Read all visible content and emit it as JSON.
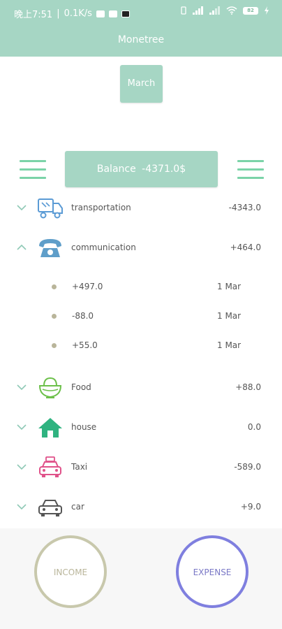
{
  "status_bar": {
    "time": "晚上7:51",
    "speed": "0.1K/s",
    "battery": "82"
  },
  "app": {
    "title": "Monetree"
  },
  "month_button": "March",
  "balance": {
    "label": "Balance",
    "value": "-4371.0$"
  },
  "categories": [
    {
      "label": "transportation",
      "amount": "-4343.0",
      "icon": "truck-icon",
      "expanded": false
    },
    {
      "label": "communication",
      "amount": "+464.0",
      "icon": "telephone-icon",
      "expanded": true,
      "entries": [
        {
          "amount": "+497.0",
          "date": "1 Mar"
        },
        {
          "amount": "-88.0",
          "date": "1 Mar"
        },
        {
          "amount": "+55.0",
          "date": "1 Mar"
        }
      ]
    },
    {
      "label": "Food",
      "amount": "+88.0",
      "icon": "rice-bowl-icon",
      "expanded": false
    },
    {
      "label": "house",
      "amount": "0.0",
      "icon": "house-icon",
      "expanded": false
    },
    {
      "label": "Taxi",
      "amount": "-589.0",
      "icon": "taxi-icon",
      "expanded": false
    },
    {
      "label": "car",
      "amount": "+9.0",
      "icon": "car-icon",
      "expanded": false
    }
  ],
  "actions": {
    "income": "INCOME",
    "expense": "EXPENSE"
  },
  "colors": {
    "primary": "#a6d6c4",
    "menu": "#7bd3a8",
    "income_ring": "#c8c8ac",
    "expense_ring": "#7f7fdf"
  }
}
